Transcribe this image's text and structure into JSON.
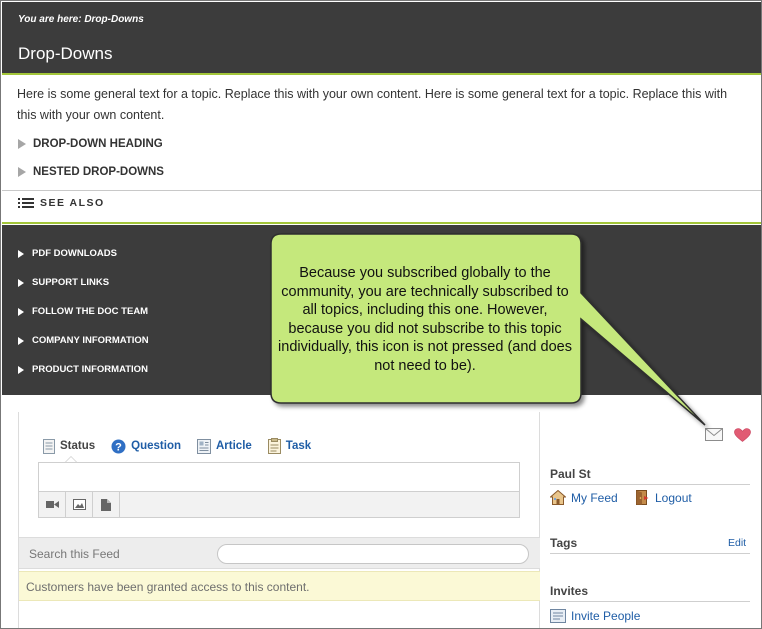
{
  "header": {
    "breadcrumb": "You are here: Drop-Downs",
    "title": "Drop-Downs"
  },
  "content": {
    "intro_line1": "Here is some general text for a topic. Replace this with your own content. Here is some general text for a topic. Replace this with",
    "intro_line2": "this with your own content.",
    "dropdowns": [
      "DROP-DOWN HEADING",
      "NESTED DROP-DOWNS"
    ],
    "see_also": "SEE ALSO"
  },
  "panel_links": [
    "PDF DOWNLOADS",
    "SUPPORT LINKS",
    "FOLLOW THE DOC TEAM",
    "COMPANY INFORMATION",
    "PRODUCT INFORMATION"
  ],
  "callout": {
    "text": "Because you subscribed globally to the community, you are technically subscribed to all topics, including this one. However, because you did not subscribe to this topic individually, this icon is not pressed (and does not need to be)."
  },
  "feed": {
    "tabs": [
      "Status",
      "Question",
      "Article",
      "Task"
    ],
    "search_label": "Search this Feed",
    "notice": "Customers have been granted access to this content."
  },
  "sidebar": {
    "user_name": "Paul St",
    "my_feed": "My Feed",
    "logout": "Logout",
    "tags_heading": "Tags",
    "edit": "Edit",
    "invites_heading": "Invites",
    "invite_people": "Invite People"
  },
  "colors": {
    "header_bg": "#3c3c3c",
    "accent_green": "#a3c639",
    "callout_fill": "#c5e87b",
    "link_blue": "#1f5da6",
    "notice_bg": "#fbf9d6"
  }
}
